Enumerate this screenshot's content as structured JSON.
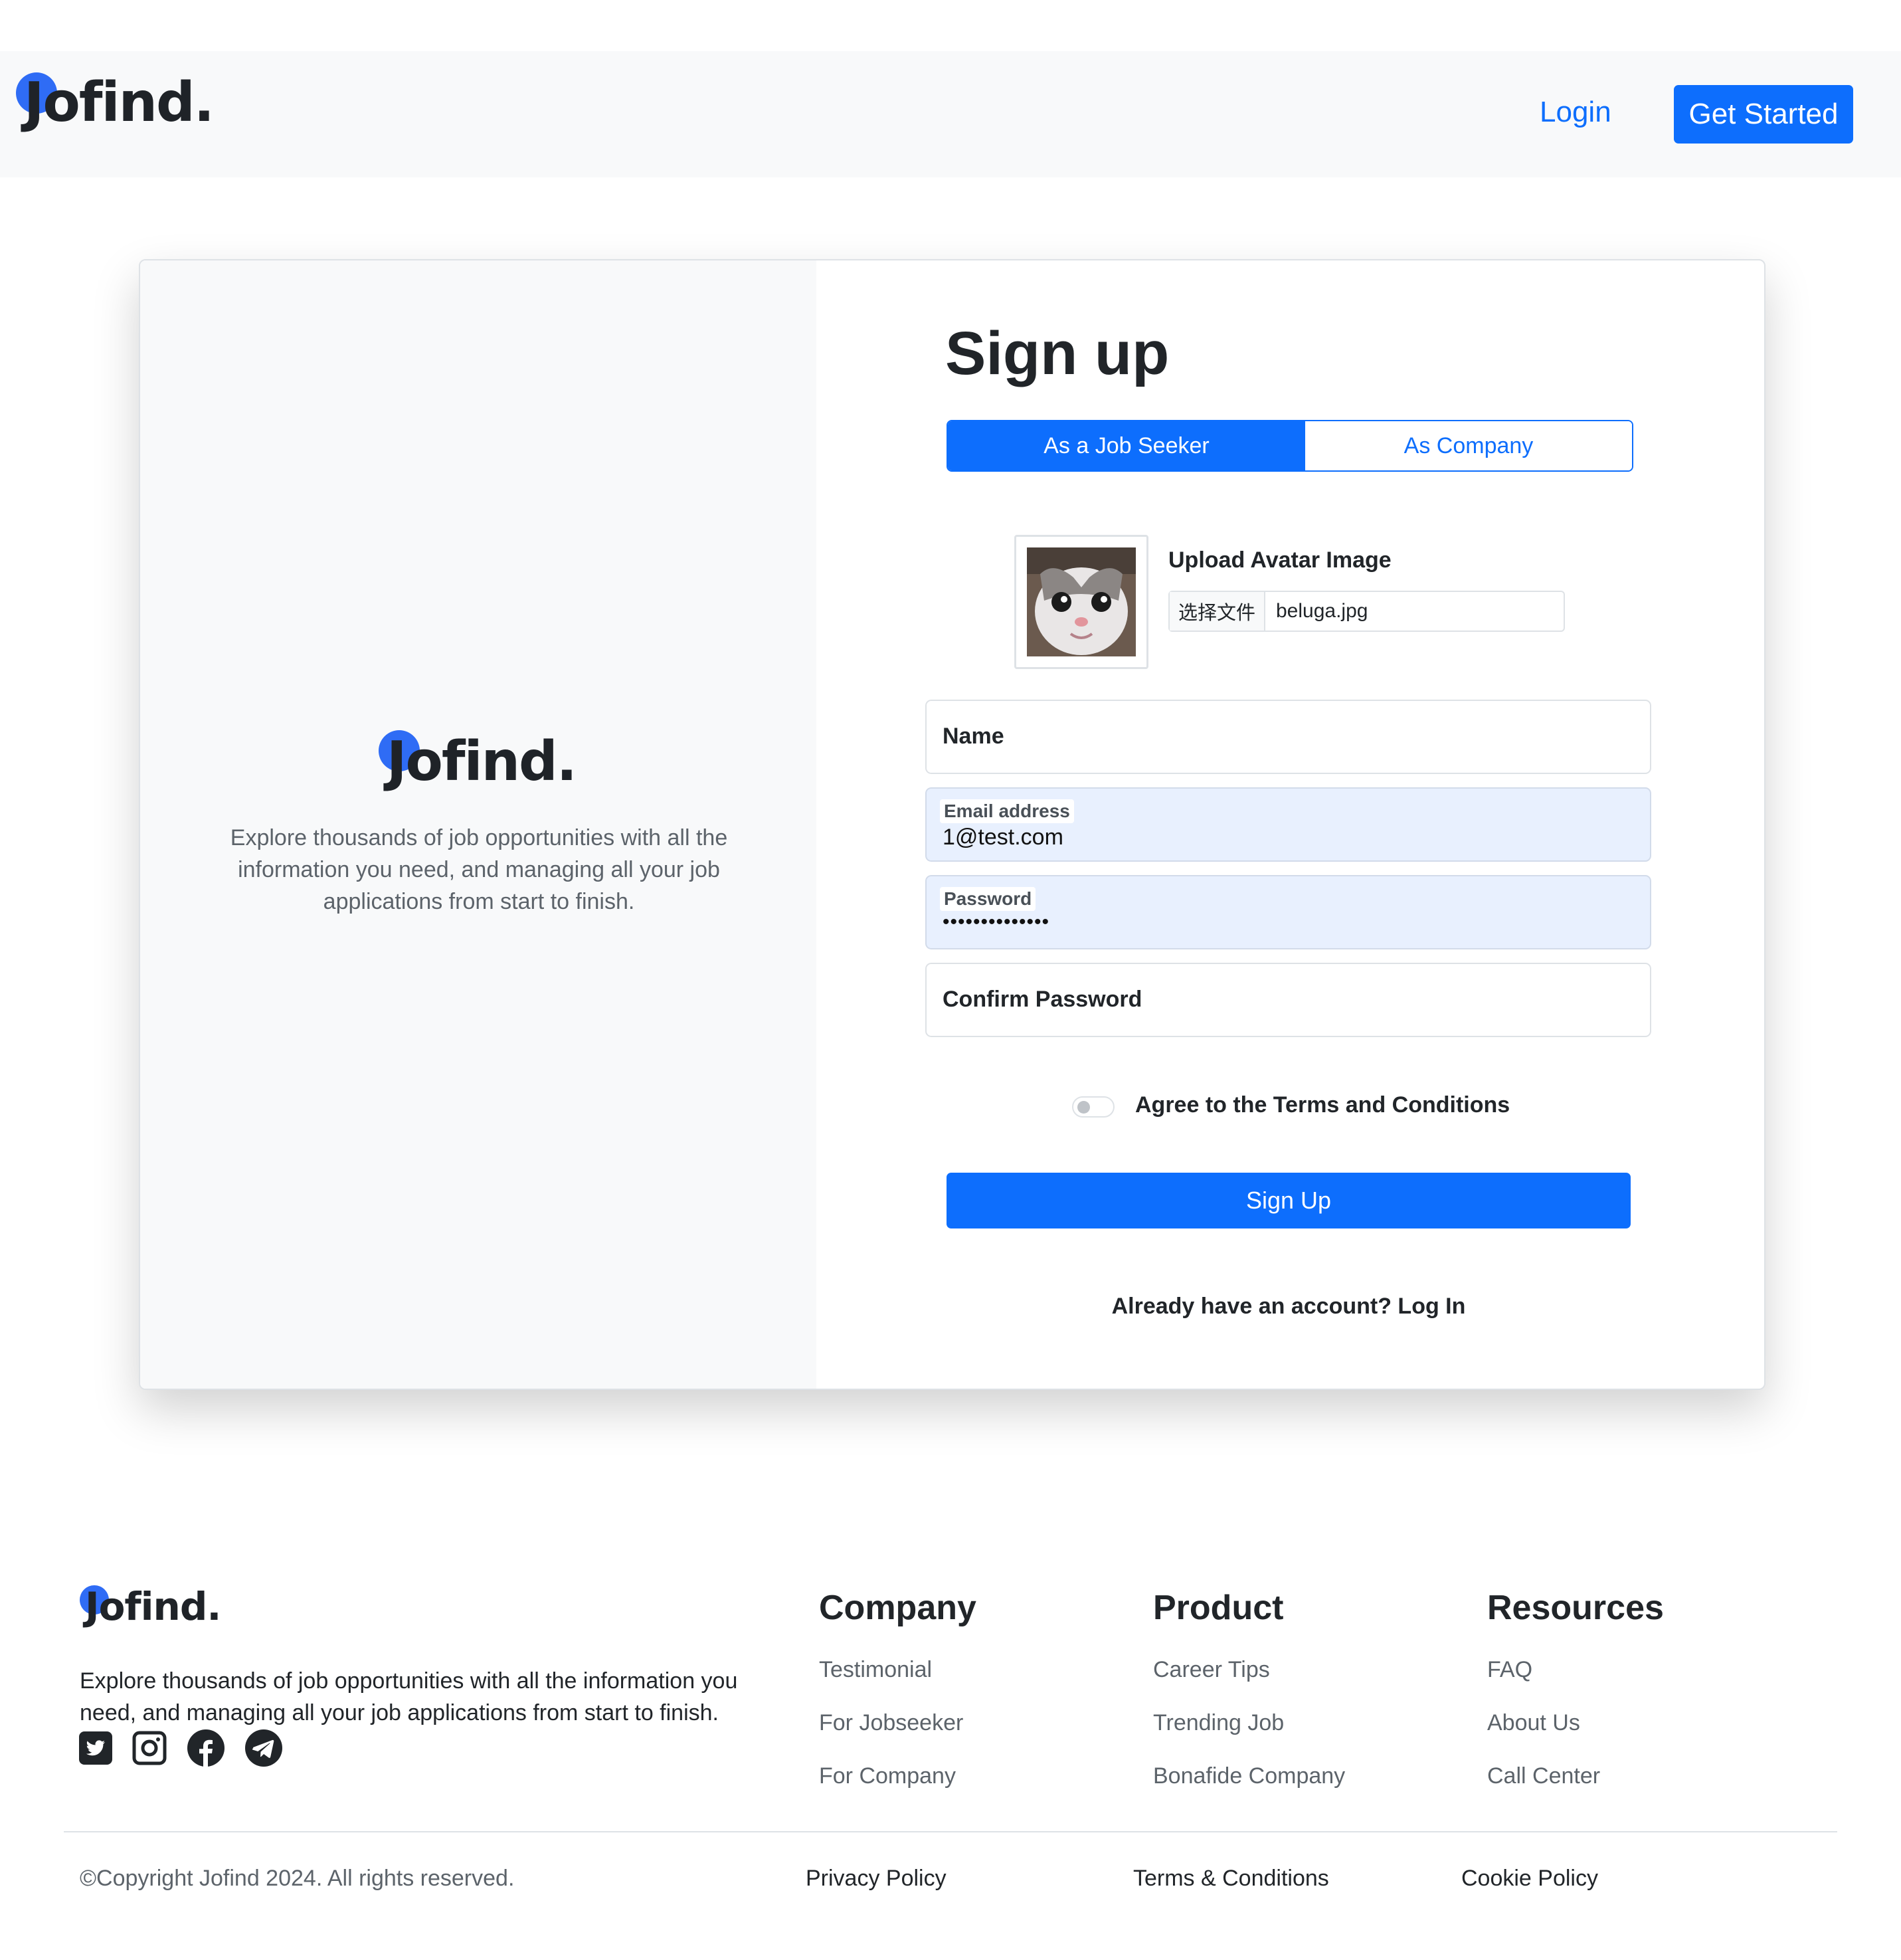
{
  "brand": {
    "name": "Jofind.",
    "color": "#2f6cf5",
    "primary": "#0d6efd"
  },
  "nav": {
    "login": "Login",
    "get_started": "Get Started"
  },
  "intro": {
    "tagline": "Explore thousands of job opportunities with all the information you need, and managing all your job applications from start to finish."
  },
  "signup": {
    "title": "Sign up",
    "tabs": [
      {
        "label": "As a Job Seeker",
        "active": true
      },
      {
        "label": "As Company",
        "active": false
      }
    ],
    "avatar": {
      "label": "Upload Avatar Image",
      "file_button": "选择文件",
      "file_name": "beluga.jpg"
    },
    "fields": {
      "name": {
        "label": "Name",
        "value": ""
      },
      "email": {
        "label": "Email address",
        "value": "1@test.com"
      },
      "password": {
        "label": "Password",
        "value": "••••••••••••••"
      },
      "confirm": {
        "label": "Confirm Password",
        "value": ""
      }
    },
    "terms": {
      "label": "Agree to the Terms and Conditions",
      "checked": false
    },
    "submit": "Sign Up",
    "login_prompt": "Already have an account? Log In"
  },
  "footer": {
    "tagline": "Explore thousands of job opportunities with all the information you need, and managing all your job applications from start to finish.",
    "social": [
      "twitter-icon",
      "instagram-icon",
      "facebook-icon",
      "telegram-icon"
    ],
    "columns": [
      {
        "title": "Company",
        "links": [
          "Testimonial",
          "For Jobseeker",
          "For Company"
        ]
      },
      {
        "title": "Product",
        "links": [
          "Career Tips",
          "Trending Job",
          "Bonafide Company"
        ]
      },
      {
        "title": "Resources",
        "links": [
          "FAQ",
          "About Us",
          "Call Center"
        ]
      }
    ],
    "copyright": "©Copyright Jofind 2024. All rights reserved.",
    "legal": [
      "Privacy Policy",
      "Terms & Conditions",
      "Cookie Policy"
    ]
  }
}
